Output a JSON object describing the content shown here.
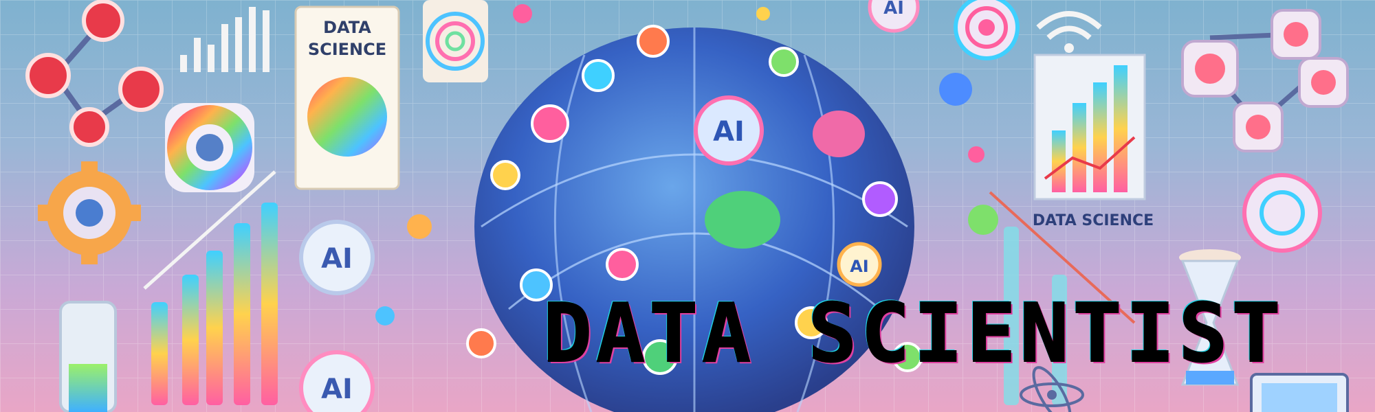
{
  "headline": "DATA SCIENTIST",
  "labels": {
    "poster_title_line1": "DATA",
    "poster_title_line2": "SCIENCE",
    "right_caption": "DATA SCIENCE",
    "ai_center": "AI",
    "ai_badge_1": "AI",
    "ai_badge_2": "AI",
    "ai_badge_3": "AI",
    "ai_badge_top": "AI"
  },
  "colors": {
    "headline": "#000000",
    "headline_shadow_pink": "#e040a0",
    "headline_shadow_cyan": "#20d0e0",
    "sphere": "#3b6fd0"
  },
  "icons": [
    "network-graph-icon",
    "bar-chart-icon",
    "donut-chart-icon",
    "gear-icon",
    "test-tube-icon",
    "brain-icon",
    "wifi-icon",
    "hourglass-icon",
    "monitor-icon",
    "atom-icon"
  ]
}
